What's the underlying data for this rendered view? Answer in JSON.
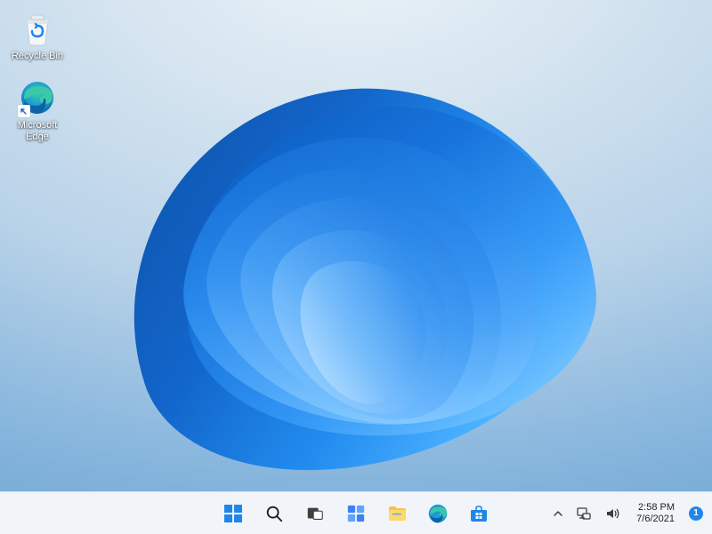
{
  "desktop_icons": {
    "recycle_bin": {
      "label": "Recycle Bin"
    },
    "edge": {
      "label": "Microsoft\nEdge"
    }
  },
  "taskbar": {
    "start": {
      "name": "Start"
    },
    "search": {
      "name": "Search"
    },
    "task_view": {
      "name": "Task View"
    },
    "widgets": {
      "name": "Widgets"
    },
    "explorer": {
      "name": "File Explorer"
    },
    "edge": {
      "name": "Microsoft Edge"
    },
    "store": {
      "name": "Microsoft Store"
    }
  },
  "systray": {
    "overflow": {
      "name": "Show hidden icons"
    },
    "network": {
      "name": "Network"
    },
    "volume": {
      "name": "Volume"
    },
    "clock": {
      "time": "2:58 PM",
      "date": "7/6/2021"
    },
    "notifications": {
      "count": "1"
    }
  }
}
